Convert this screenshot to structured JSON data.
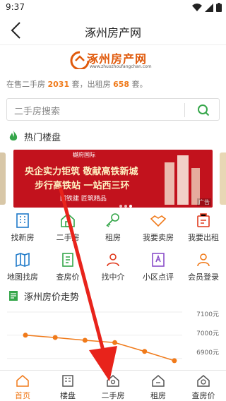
{
  "status": {
    "time": "9:37"
  },
  "nav": {
    "title": "涿州房产网"
  },
  "logo": {
    "text": "涿州房产网",
    "sub": "www.zhuozhoufangchan.com"
  },
  "stats": {
    "prefix": "在售二手房",
    "sale_count": "2031",
    "mid": "套，出租房",
    "rent_count": "658",
    "suffix": "套。"
  },
  "search": {
    "placeholder": "二手房搜索"
  },
  "hot": {
    "title": "热门楼盘"
  },
  "banner": {
    "brand": "樾府国际",
    "line1": "央企实力钜筑  敬献高铁新城",
    "line2": "步行高铁站  一站西三环",
    "line3": "国铁建  匠筑精品",
    "ad": "广告"
  },
  "grid": [
    {
      "label": "找新房",
      "icon": "building-icon"
    },
    {
      "label": "二手房",
      "icon": "house-icon"
    },
    {
      "label": "租房",
      "icon": "key-icon"
    },
    {
      "label": "我要卖房",
      "icon": "handshake-icon"
    },
    {
      "label": "我要出租",
      "icon": "rent-out-icon"
    },
    {
      "label": "地图找房",
      "icon": "map-icon"
    },
    {
      "label": "查房价",
      "icon": "price-check-icon"
    },
    {
      "label": "找中介",
      "icon": "agent-icon"
    },
    {
      "label": "小区点评",
      "icon": "review-icon"
    },
    {
      "label": "会员登录",
      "icon": "user-icon"
    }
  ],
  "price_trend": {
    "title": "涿州房价走势"
  },
  "chart_data": {
    "type": "line",
    "title": "涿州房价走势",
    "yticks": [
      "7100元",
      "7000元",
      "6900元"
    ],
    "ylim": [
      6850,
      7100
    ],
    "series": [
      {
        "values": [
          7000,
          6990,
          6978,
          6968,
          6930,
          6890
        ]
      }
    ],
    "colors": {
      "line": "#f07a1a"
    }
  },
  "tabs": [
    {
      "label": "首页",
      "icon": "home-icon",
      "active": true
    },
    {
      "label": "楼盘",
      "icon": "building-icon"
    },
    {
      "label": "二手房",
      "icon": "house-icon"
    },
    {
      "label": "租房",
      "icon": "rent-icon"
    },
    {
      "label": "查房价",
      "icon": "price-icon"
    }
  ],
  "colors": {
    "accent": "#f07a1a",
    "brand": "#e05a0c",
    "green": "#35a64a",
    "banner": "#c2121d",
    "arrow": "#e8231b"
  }
}
